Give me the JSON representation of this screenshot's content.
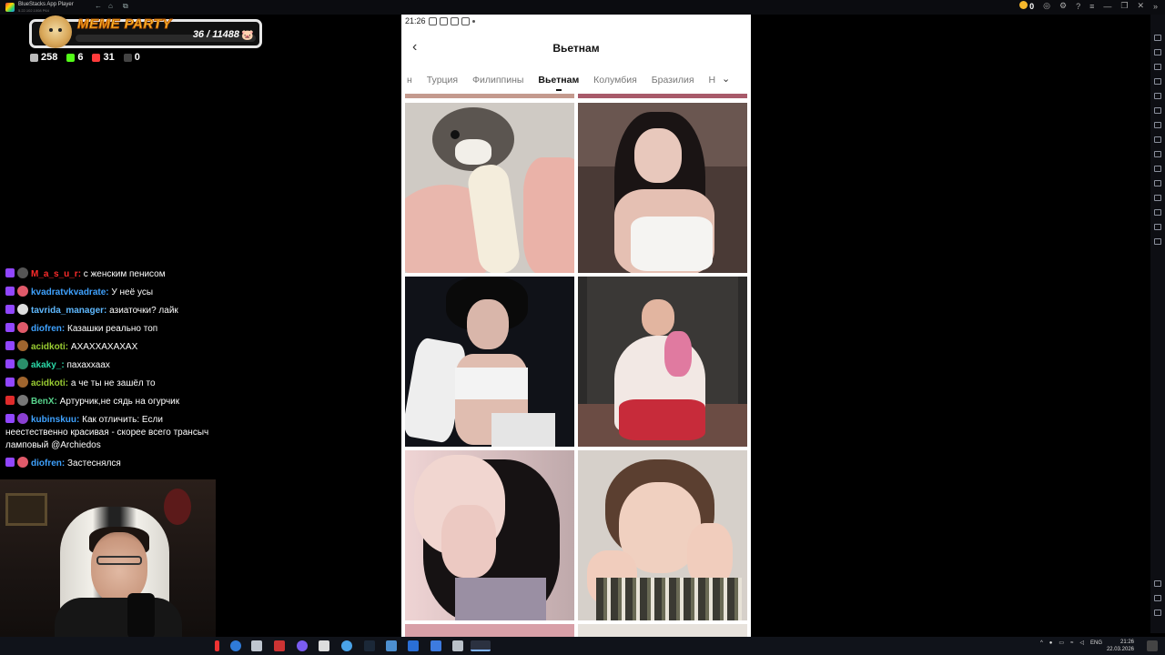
{
  "window": {
    "app_title": "BlueStacks App Player",
    "app_subtitle": "5.22.102.1008 P64",
    "coins": "0"
  },
  "overlay": {
    "brand": "MEME PARTY",
    "score": "36 / 11488",
    "stats": [
      {
        "icon": "twitch-viewers-icon",
        "value": "258",
        "color": "#ffffff"
      },
      {
        "icon": "kick-icon",
        "value": "6",
        "color": "#53fc18"
      },
      {
        "icon": "vk-live-icon",
        "value": "31",
        "color": "#ff3b3b"
      },
      {
        "icon": "w-icon",
        "value": "0",
        "color": "#ffffff"
      }
    ]
  },
  "chat": [
    {
      "user": "M_a_s_u_r:",
      "text": " с женским пенисом",
      "color": "#ff2b2b",
      "platform": "twitch"
    },
    {
      "user": "kvadratvkvadrate:",
      "text": " У неё усы",
      "color": "#3fa2ff",
      "platform": "twitch"
    },
    {
      "user": "tavrida_manager:",
      "text": " азиаточки? лайк",
      "color": "#5fb9ff",
      "platform": "twitch"
    },
    {
      "user": "diofren:",
      "text": " Казашки реально топ",
      "color": "#3fa2ff",
      "platform": "twitch"
    },
    {
      "user": "acidkoti:",
      "text": " АХАХХАХАХАХ",
      "color": "#9acd32",
      "platform": "twitch"
    },
    {
      "user": "akaky_:",
      "text": " пахаххаах",
      "color": "#2bd9a8",
      "platform": "twitch"
    },
    {
      "user": "acidkoti:",
      "text": " а че ты не зашёл то",
      "color": "#9acd32",
      "platform": "twitch"
    },
    {
      "user": "BenX:",
      "text": " Артурчик,не сядь на огурчик",
      "color": "#57d38c",
      "platform": "vk"
    },
    {
      "user": "kubinskuu:",
      "text": " Как отличить: Если неестественно красивая - скорее всего трансыч ламповый @Archiedos",
      "color": "#3fa2ff",
      "platform": "twitch"
    },
    {
      "user": "diofren:",
      "text": " Застеснялся",
      "color": "#3fa2ff",
      "platform": "twitch"
    }
  ],
  "phone": {
    "time": "21:26",
    "page_title": "Вьетнам",
    "tabs": [
      "н",
      "Турция",
      "Филиппины",
      "Вьетнам",
      "Колумбия",
      "Бразилия",
      "Н"
    ],
    "active_tab": "Вьетнам"
  },
  "taskbar": {
    "lang": "ENG",
    "time": "21:26",
    "date": "22.03.2026"
  }
}
